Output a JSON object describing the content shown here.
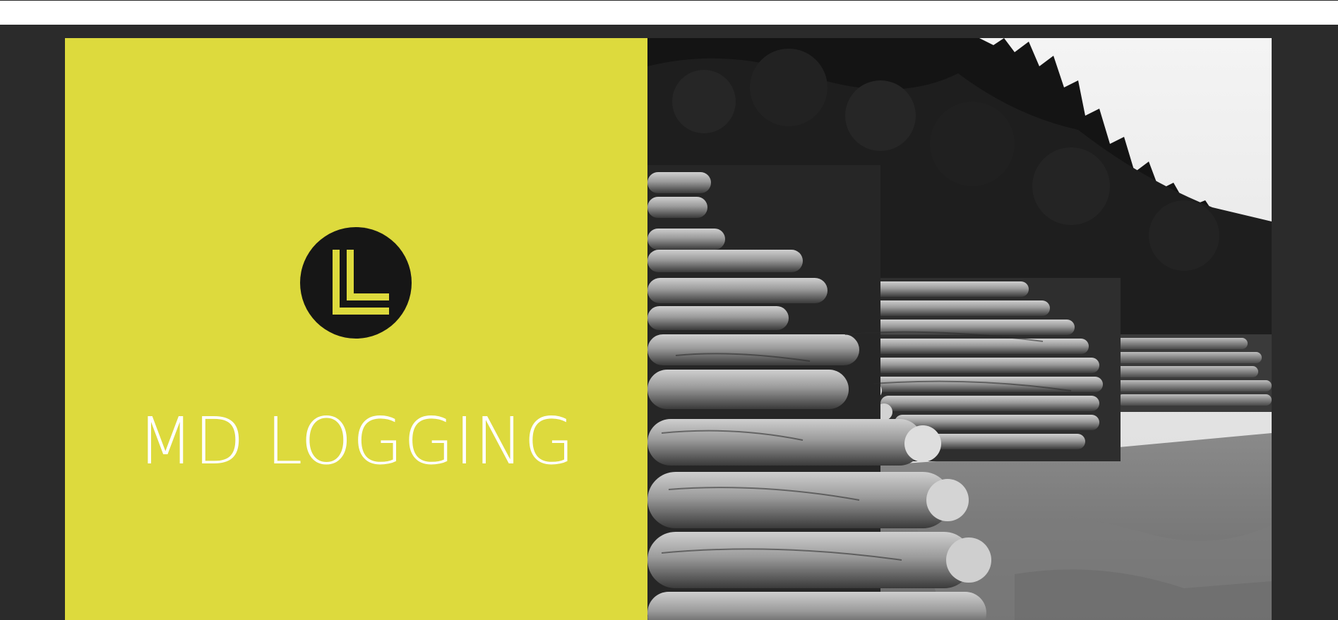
{
  "brand": {
    "name": "MD LOGGING",
    "logo_icon": "ll-monogram-icon",
    "accent_color": "#ddda3d",
    "badge_color": "#161616"
  },
  "page": {
    "background_color": "#2b2b2b"
  },
  "hero_image": {
    "icon": "log-pile-photo",
    "style": "black-and-white"
  }
}
